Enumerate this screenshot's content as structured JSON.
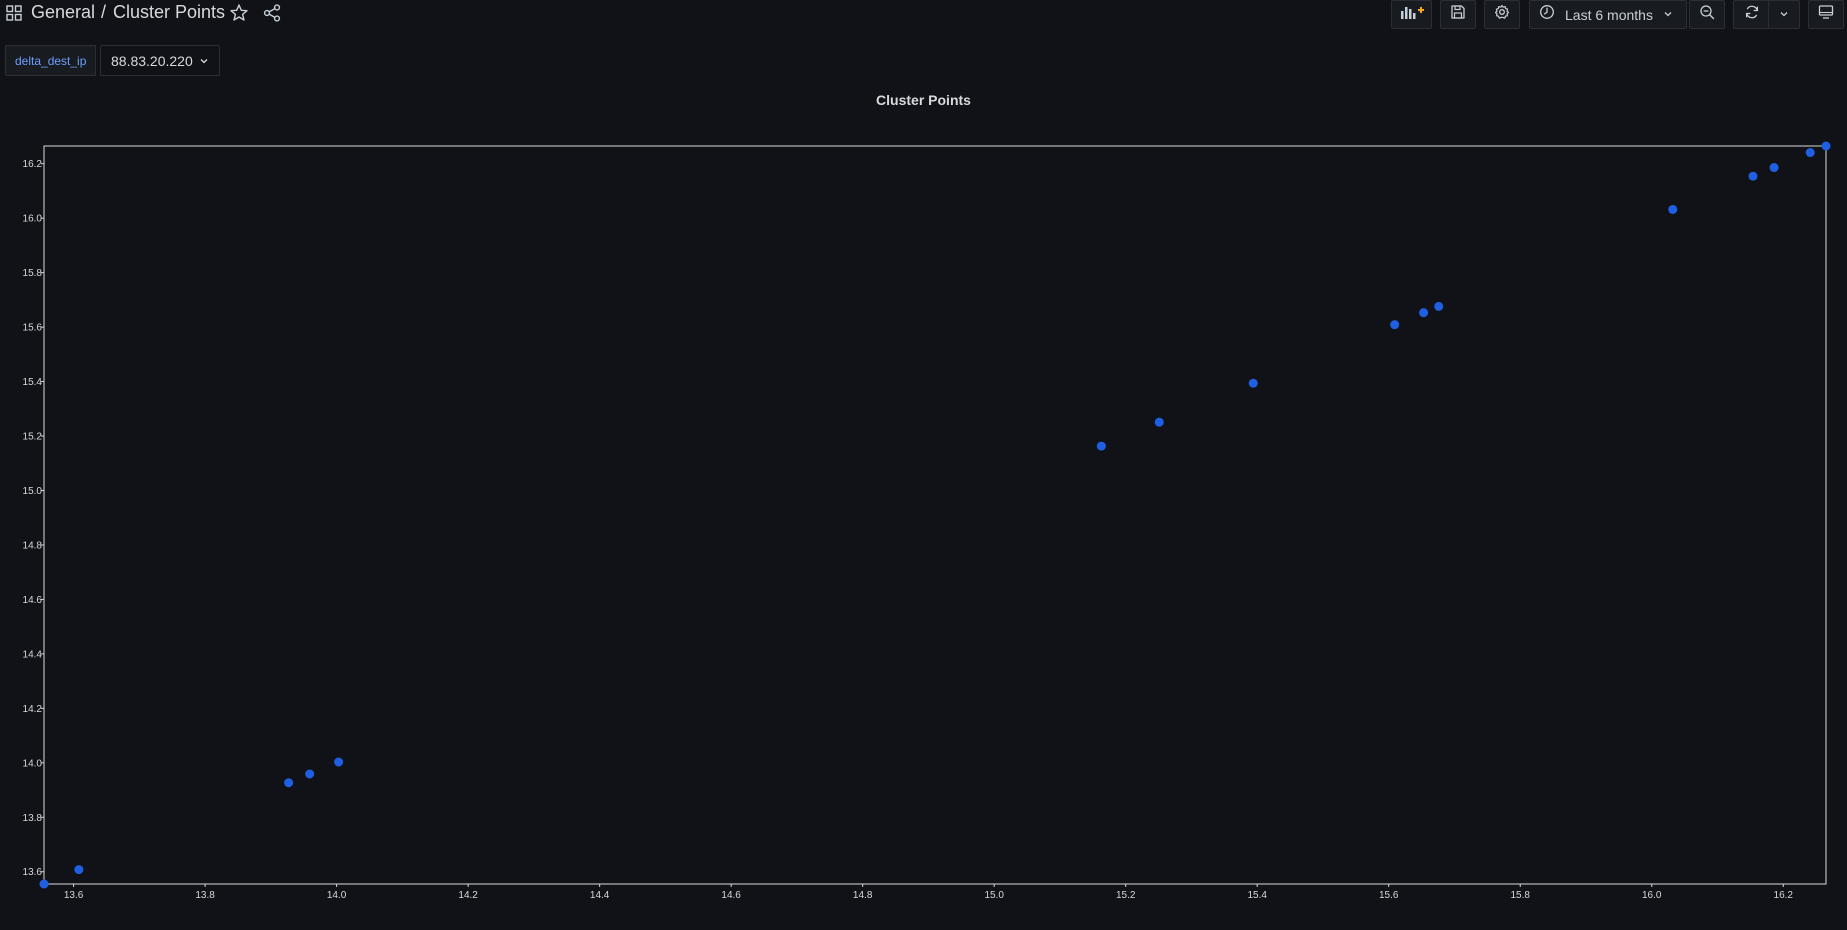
{
  "header": {
    "folder": "General",
    "separator": "/",
    "title": "Cluster Points",
    "icons": {
      "apps": "grid-icon",
      "star": "star-icon",
      "share": "share-icon"
    }
  },
  "toolbar": {
    "time_range": "Last 6 months",
    "icons": {
      "add_panel": "add-panel-icon",
      "save": "save-icon",
      "settings": "gear-icon",
      "clock": "clock-icon",
      "zoom_out": "zoom-out-icon",
      "refresh": "refresh-icon",
      "refresh_interval": "chevron-down-icon",
      "tv_mode": "monitor-icon"
    },
    "colors": {
      "add_panel_accent": "#f5a623"
    }
  },
  "variables": [
    {
      "name": "delta_dest_ip",
      "value": "88.83.20.220"
    }
  ],
  "panel": {
    "title": "Cluster Points"
  },
  "chart_data": {
    "type": "scatter",
    "title": "Cluster Points",
    "xlabel": "",
    "ylabel": "",
    "xlim": [
      13.555,
      16.265
    ],
    "ylim": [
      13.555,
      16.265
    ],
    "xticks": [
      "13.6",
      "13.8",
      "14.0",
      "14.2",
      "14.4",
      "14.6",
      "14.8",
      "15.0",
      "15.2",
      "15.4",
      "15.6",
      "15.8",
      "16.0",
      "16.2"
    ],
    "yticks": [
      "13.6",
      "13.8",
      "14.0",
      "14.2",
      "14.4",
      "14.6",
      "14.8",
      "15.0",
      "15.2",
      "15.4",
      "15.6",
      "15.8",
      "16.0",
      "16.2"
    ],
    "grid": false,
    "point_color": "#1f60e3",
    "x": [
      13.555,
      13.608,
      13.927,
      13.959,
      14.003,
      15.163,
      15.251,
      15.394,
      15.609,
      15.653,
      15.676,
      16.032,
      16.154,
      16.186,
      16.241,
      16.265
    ],
    "y": [
      13.555,
      13.608,
      13.927,
      13.959,
      14.003,
      15.163,
      15.251,
      15.394,
      15.609,
      15.653,
      15.676,
      16.032,
      16.154,
      16.186,
      16.241,
      16.265
    ]
  }
}
